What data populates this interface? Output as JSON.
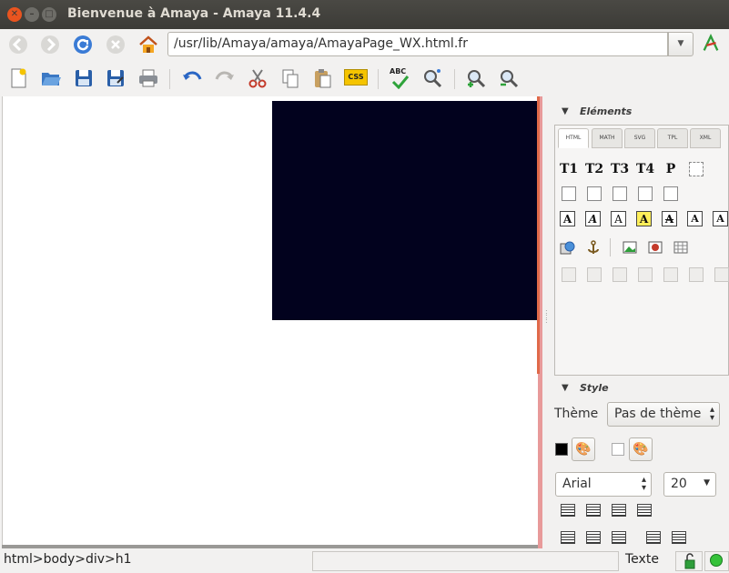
{
  "window": {
    "title": "Bienvenue à Amaya - Amaya 11.4.4",
    "close": "✕",
    "minimize": "–",
    "maximize": "□"
  },
  "nav": {
    "url": "/usr/lib/Amaya/amaya/AmayaPage_WX.html.fr",
    "dropdown": "▼"
  },
  "toolbar": {
    "css_label": "CSS",
    "abc_label": "ABC"
  },
  "elements_panel": {
    "title": "Eléments",
    "tabs": [
      "HTML",
      "MATH",
      "SVG",
      "TPL",
      "XML"
    ],
    "heading_buttons": [
      "T1",
      "T2",
      "T3",
      "T4",
      "P"
    ],
    "text_buttons": [
      "A",
      "A",
      "A",
      "A",
      "A",
      "A",
      "A"
    ]
  },
  "style_panel": {
    "title": "Style",
    "theme_label": "Thème",
    "theme_value": "Pas de thème",
    "font_value": "Arial",
    "size_value": "20"
  },
  "status": {
    "path": "html>body>div>h1",
    "mode": "Texte"
  },
  "colors": {
    "dark_block": "#02021e",
    "accent": "#e06a4a",
    "title_bar": "#3c3b37"
  }
}
